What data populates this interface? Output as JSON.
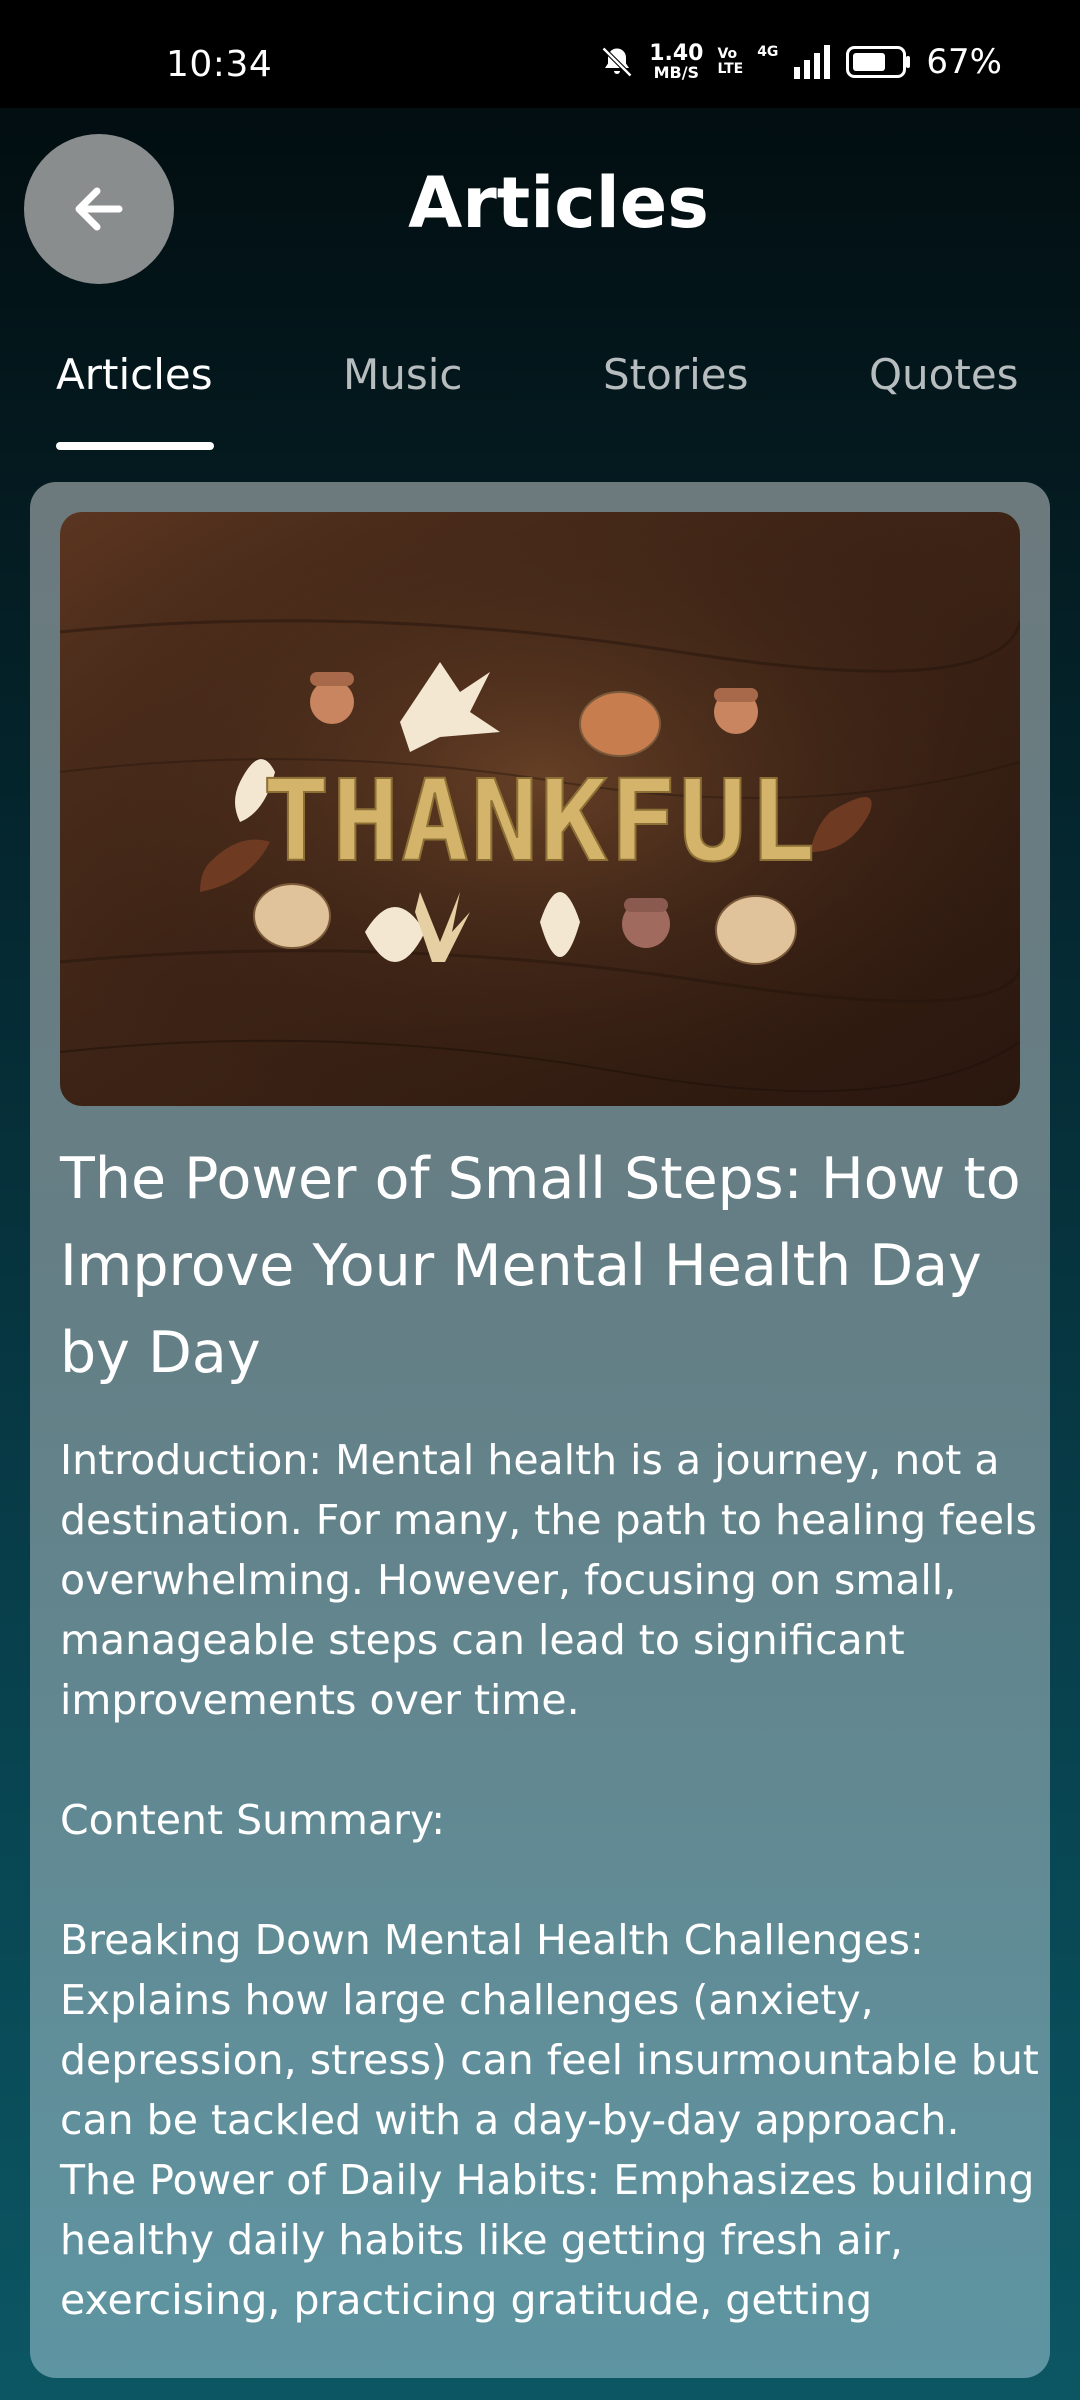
{
  "status_bar": {
    "time": "10:34",
    "net_speed_value": "1.40",
    "net_speed_unit": "MB/S",
    "volte_top": "Vo",
    "volte_bottom": "LTE",
    "network_type": "4G",
    "battery": "67%"
  },
  "header": {
    "title": "Articles",
    "back_icon": "arrow-left-icon"
  },
  "tabs": [
    {
      "label": "Articles",
      "active": true
    },
    {
      "label": "Music",
      "active": false
    },
    {
      "label": "Stories",
      "active": false
    },
    {
      "label": "Quotes",
      "active": false
    }
  ],
  "article": {
    "image_text": "THANKFUL",
    "title": "The Power of Small Steps: How to Improve Your Mental Health Day by Day",
    "body": "Introduction: Mental health is a journey, not a destination. For many, the path to healing feels overwhelming. However, focusing on small, manageable steps can lead to significant improvements over time.\n\nContent Summary:\n\nBreaking Down Mental Health Challenges: Explains how large challenges (anxiety, depression, stress) can feel insurmountable but can be tackled with a day-by-day approach.\nThe Power of Daily Habits: Emphasizes building healthy daily habits like getting fresh air, exercising, practicing gratitude, getting"
  },
  "colors": {
    "background_top": "#020a0c",
    "background_bottom": "#0c5663",
    "card": "#647f86",
    "back_button": "#8a8d8e",
    "tab_inactive": "#b7bcbe"
  }
}
